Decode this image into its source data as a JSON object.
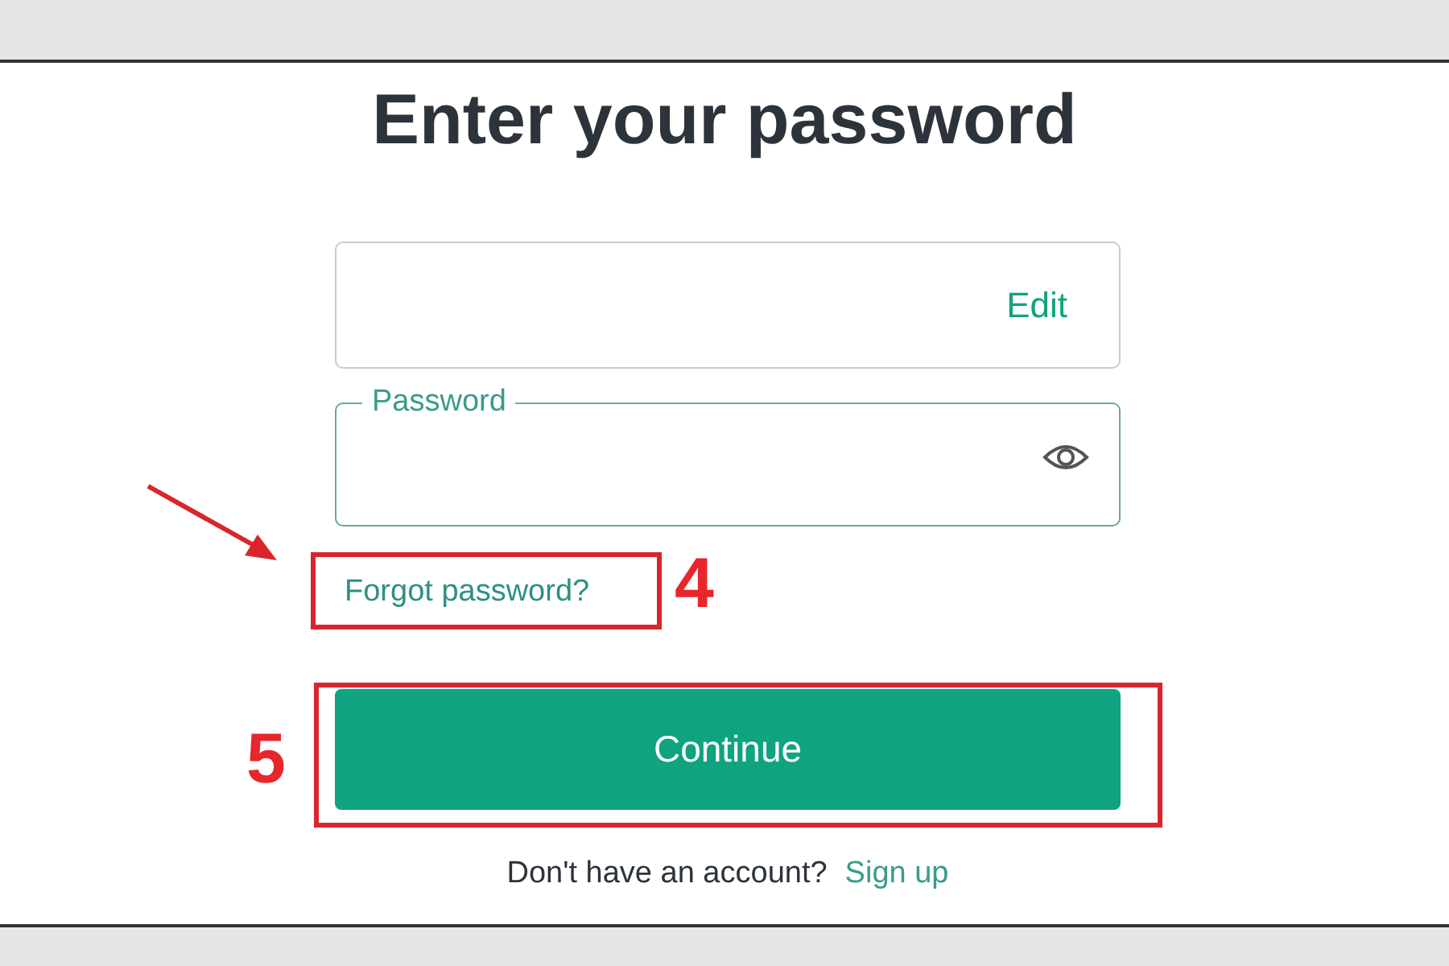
{
  "title": "Enter your password",
  "email_field": {
    "action": "Edit"
  },
  "password_field": {
    "label": "Password"
  },
  "forgot_link": "Forgot password?",
  "continue_button": "Continue",
  "signup": {
    "prompt": "Don't have an account?",
    "link": "Sign up"
  },
  "annotations": [
    {
      "number": "4"
    },
    {
      "number": "5"
    }
  ]
}
